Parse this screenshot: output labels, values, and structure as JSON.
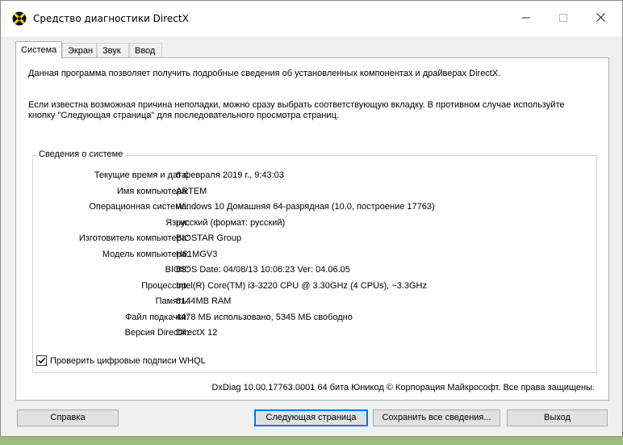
{
  "window": {
    "title": "Средство диагностики DirectX"
  },
  "tabs": [
    {
      "label": "Система",
      "active": true
    },
    {
      "label": "Экран",
      "active": false
    },
    {
      "label": "Звук",
      "active": false
    },
    {
      "label": "Ввод",
      "active": false
    }
  ],
  "intro": {
    "line1": "Данная программа позволяет получить подробные сведения об установленных компонентах и драйверах DirectX.",
    "line2a": "Если известна возможная причина неполадки, можно сразу выбрать соответствующую вкладку. В противном случае используйте",
    "line2b": "кнопку \"Следующая страница\" для последовательного просмотра страниц."
  },
  "system_info": {
    "title": "Сведения о системе",
    "rows": [
      {
        "label": "Текущие время и дата:",
        "value": "6 февраля 2019 г., 9:43:03"
      },
      {
        "label": "Имя компьютера:",
        "value": "ARTEM"
      },
      {
        "label": "Операционная система:",
        "value": "Windows 10 Домашняя 64-разрядная (10.0, построение 17763)"
      },
      {
        "label": "Язык:",
        "value": "русский (формат: русский)"
      },
      {
        "label": "Изготовитель компьютера:",
        "value": "BIOSTAR Group"
      },
      {
        "label": "Модель компьютера:",
        "value": "H61MGV3"
      },
      {
        "label": "BIOS:",
        "value": "BIOS Date: 04/08/13 10:06:23 Ver: 04.06.05"
      },
      {
        "label": "Процессор:",
        "value": "Intel(R) Core(TM) i3-3220 CPU @ 3.30GHz (4 CPUs), ~3.3GHz"
      },
      {
        "label": "Память:",
        "value": "6144MB RAM"
      },
      {
        "label": "Файл подкачки:",
        "value": "4478 МБ использовано, 5345 МБ свободно"
      },
      {
        "label": "Версия DirectX:",
        "value": "DirectX 12"
      }
    ]
  },
  "whql_checkbox": {
    "label": "Проверить цифровые подписи WHQL",
    "checked": true
  },
  "copyright": "DxDiag 10.00.17763.0001 64 бита Юникод  © Корпорация Майкрософт. Все права защищены.",
  "buttons": {
    "help": "Справка",
    "next_page": "Следующая страница",
    "save_all": "Сохранить все сведения...",
    "exit": "Выход"
  },
  "icons": {
    "app": "directx-icon",
    "minimize": "minimize-icon",
    "maximize": "maximize-icon",
    "close": "close-icon",
    "check": "check-icon"
  }
}
